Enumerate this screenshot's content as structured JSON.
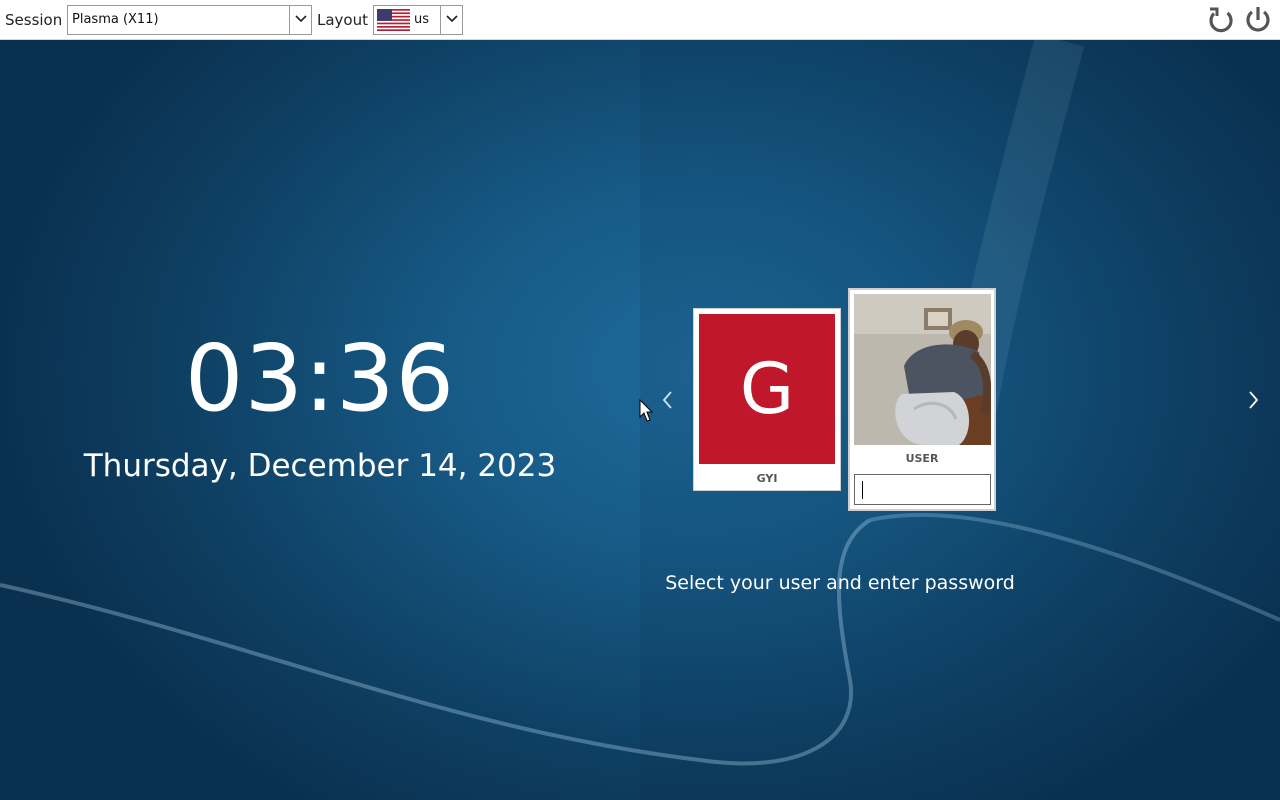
{
  "topbar": {
    "session_label": "Session",
    "session_value": "Plasma (X11)",
    "layout_label": "Layout",
    "layout_value": "us",
    "layout_flag": "us-flag-icon",
    "restart_icon": "restart-icon",
    "power_icon": "power-icon"
  },
  "clock": {
    "time": "03:36",
    "date": "Thursday, December 14, 2023"
  },
  "users": [
    {
      "name": "GYI",
      "avatar_letter": "G",
      "avatar_color": "#c0182a"
    },
    {
      "name": "USER",
      "avatar": "user-photo",
      "password_value": ""
    }
  ],
  "hint": "Select your user and enter password",
  "colors": {
    "background": "#175b87",
    "topbar": "#ffffff",
    "avatar_red": "#c0182a"
  }
}
